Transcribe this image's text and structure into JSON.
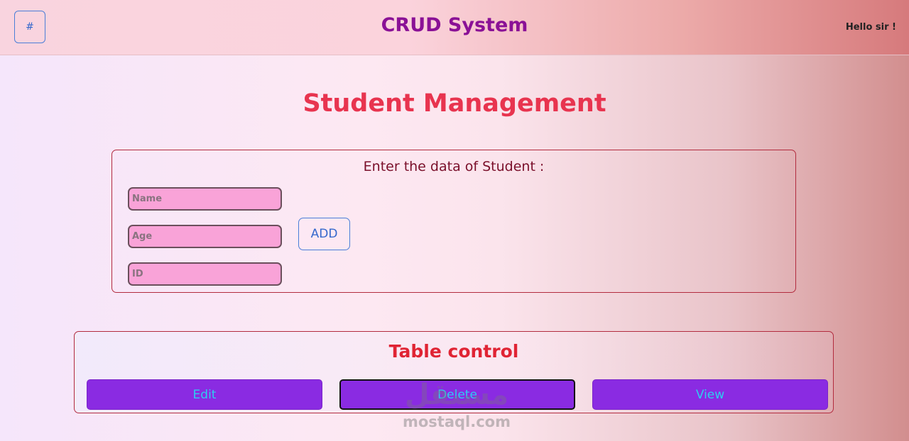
{
  "header": {
    "menu_button_label": "#",
    "app_title": "CRUD System",
    "greeting": "Hello sir !"
  },
  "page": {
    "title": "Student Management"
  },
  "form": {
    "heading": "Enter the data of Student :",
    "name_placeholder": "Name",
    "age_placeholder": "Age",
    "id_placeholder": "ID",
    "add_label": "ADD"
  },
  "table_control": {
    "heading": "Table control",
    "edit_label": "Edit",
    "delete_label": "Delete",
    "view_label": "View"
  },
  "watermark": {
    "logo": "مستقل",
    "text": "mostaql.com"
  },
  "colors": {
    "title": "#e8344f",
    "app_title": "#8a1196",
    "button_purple": "#8a2be2",
    "button_text": "#2ecdf0",
    "field_pink": "#f9a3d8",
    "panel_border": "#b22b3e"
  }
}
